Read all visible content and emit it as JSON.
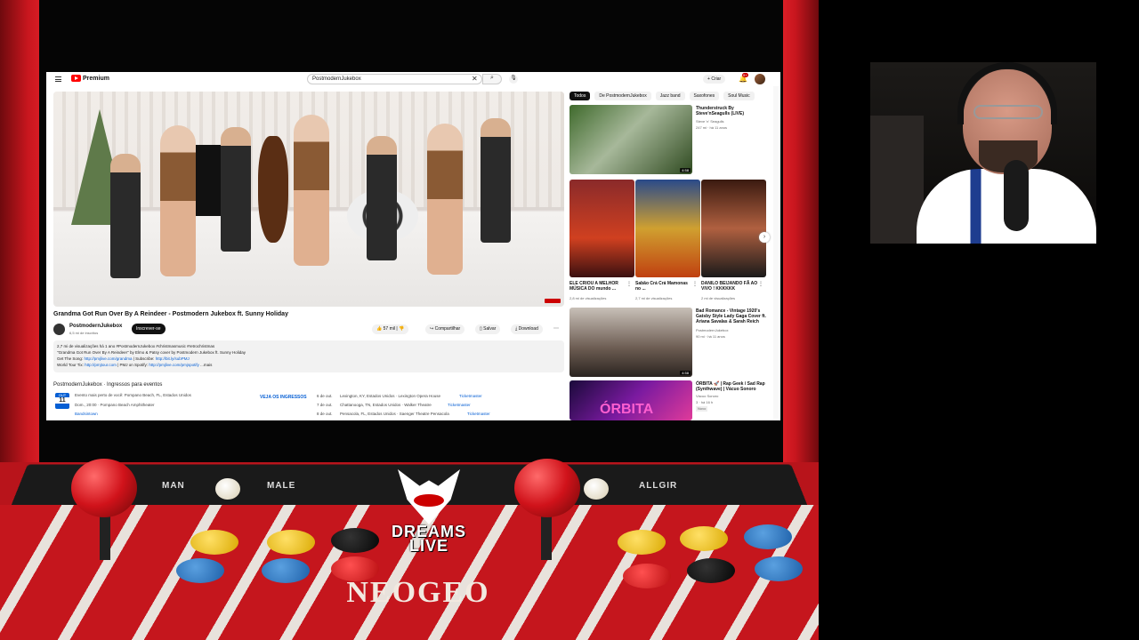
{
  "youtube": {
    "logo_text": "Premium",
    "search_value": "PostmodernJukebox",
    "create_label": "Criar",
    "notif_count": "9+",
    "video": {
      "title": "Grandma Got Run Over By A Reindeer - Postmodern Jukebox ft. Sunny Holiday",
      "channel": "PostmodernJukebox",
      "subscribers": "6,5 mi de inscritos",
      "subscribe_label": "Inscrever-se",
      "likes": "57 mil",
      "share_label": "Compartilhar",
      "save_label": "Salvar",
      "download_label": "Download"
    },
    "description": {
      "stats": "2,7 mi de visualizações  há 1 ano  #PostmodernJukebox #christmasmusic #retrochristmas",
      "line1": "\"Grandma Got Run Over By A Reindeer\" by Elmo & Patsy cover by Postmodern Jukebox ft. Sunny Holiday",
      "line2_label": "Get The Song:",
      "line2_link1": "http://pmjlive.com/grandma",
      "line2_mid": " | Subscribe:",
      "line2_link2": "http://bit.ly/subPMJ",
      "line3_label": "World Tour Tix:",
      "line3_link1": "http://pmjtour.com",
      "line3_mid": " | PMJ on Spotify:",
      "line3_link2": "http://pmjlive.com/pmjspotify",
      "more": "...mais"
    },
    "events": {
      "header": "PostmodernJukebox · Ingressos para eventos",
      "date_month": "OUT",
      "date_day": "11",
      "first_title": "Evento mais perto de você: Pompano Beach, FL, Estados Unidos",
      "first_sub": "Dom., 20:00 · Pompano Beach Amphitheater",
      "first_link": "Bandsintown",
      "buy_label": "VEJA OS INGRESSOS",
      "rows": [
        {
          "date": "6 de out.",
          "place": "Lexington, KY, Estados Unidos · Lexington Opera House",
          "vendor": "Ticketmaster"
        },
        {
          "date": "7 de out.",
          "place": "Chattanooga, TN, Estados Unidos · Walker Theatre",
          "vendor": "Ticketmaster"
        },
        {
          "date": "8 de out.",
          "place": "Pensacola, FL, Estados Unidos · Saenger Theatre Pensacola",
          "vendor": "Ticketmaster"
        }
      ]
    },
    "chips": [
      "Todos",
      "De PostmodernJukebox",
      "Jazz band",
      "Saxofones",
      "Soul Music"
    ],
    "rec_top": {
      "title": "Thunderstruck By Steve'nSeagulls (LIVE)",
      "channel": "Steve 'n' Seagulls",
      "meta": "247 mi · há 11 anos",
      "duration": "4:58"
    },
    "shorts": [
      {
        "title": "ELE CRIOU A MELHOR MÚSICA DO mundo ...",
        "views": "2,8 mi de visualizações"
      },
      {
        "title": "Sabão Crá Crá Mamonas no ...",
        "views": "2,7 mi de visualizações"
      },
      {
        "title": "DANILO BEIJANDO FÃ AO VIVO ! KKKKKK",
        "views": "2 mi de visualizações"
      }
    ],
    "rec_mid": {
      "title": "Bad Romance - Vintage 1920's Gatsby Style Lady Gaga Cover ft. Ariana Savalas & Sarah Reich",
      "channel": "PostmodernJukebox",
      "meta": "90 mi · há 11 anos",
      "duration": "4:58"
    },
    "rec_bottom": {
      "title": "ÓRBITA 🚀 | Rap Geek / Sad Rap (Synthwave) | Vácuo Sonoro",
      "channel": "Vácuo Sonoro",
      "meta": "3 · há 16 h",
      "badge": "Novo",
      "thumb_text": "ÓRBITA"
    }
  },
  "arcade": {
    "brand": "NEOGEO",
    "logo_line1": "DREAMS",
    "logo_line2": "LIVE",
    "label_left1": "MAN",
    "label_left2": "MALE",
    "label_right": "ALLGIR"
  },
  "colors": {
    "cabinet_red": "#b8141b",
    "youtube_red": "#ff0000",
    "link_blue": "#065fd4"
  }
}
